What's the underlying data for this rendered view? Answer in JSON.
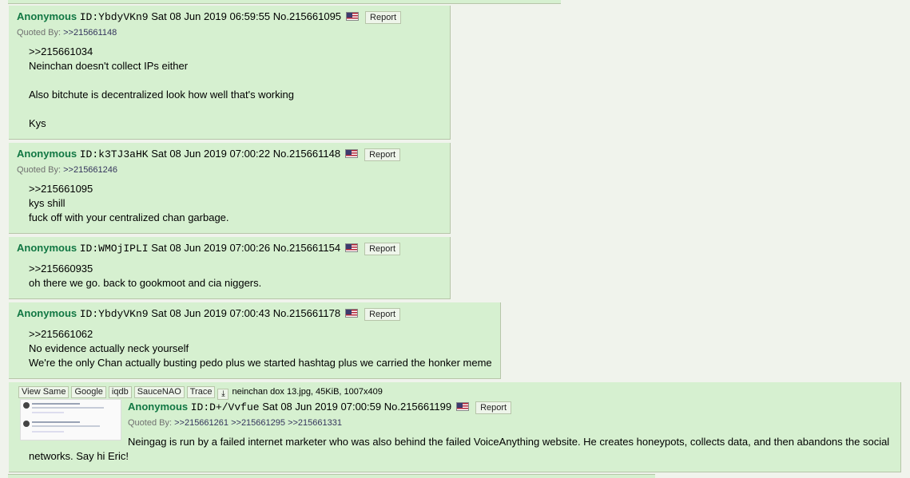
{
  "posts": [
    {
      "name": "Anonymous",
      "id": "ID:YbdyVKn9",
      "datetime": "Sat 08 Jun 2019 06:59:55",
      "no": "No.215661095",
      "report": "Report",
      "quoted_by_label": "Quoted By:",
      "quoted_by": [
        ">>215661148"
      ],
      "lines": [
        ">>215661034",
        "Neinchan doesn't collect IPs either",
        "",
        "Also bitchute is decentralized look how well that's working",
        "",
        "Kys"
      ]
    },
    {
      "name": "Anonymous",
      "id": "ID:k3TJ3aHK",
      "datetime": "Sat 08 Jun 2019 07:00:22",
      "no": "No.215661148",
      "report": "Report",
      "quoted_by_label": "Quoted By:",
      "quoted_by": [
        ">>215661246"
      ],
      "lines": [
        ">>215661095",
        "kys shill",
        "fuck off with your centralized chan garbage."
      ]
    },
    {
      "name": "Anonymous",
      "id": "ID:WMOjIPLI",
      "datetime": "Sat 08 Jun 2019 07:00:26",
      "no": "No.215661154",
      "report": "Report",
      "lines": [
        ">>215660935",
        "oh there we go. back to gookmoot and cia niggers."
      ]
    },
    {
      "name": "Anonymous",
      "id": "ID:YbdyVKn9",
      "datetime": "Sat 08 Jun 2019 07:00:43",
      "no": "No.215661178",
      "report": "Report",
      "lines": [
        ">>215661062",
        "No evidence actually neck yourself",
        "We're the only Chan actually busting pedo plus we started hashtag plus we carried the honker meme"
      ]
    },
    {
      "name": "Anonymous",
      "id": "ID:D+/Vvfue",
      "datetime": "Sat 08 Jun 2019 07:00:59",
      "no": "No.215661199",
      "report": "Report",
      "quoted_by_label": "Quoted By:",
      "quoted_by": [
        ">>215661261",
        ">>215661295",
        ">>215661331"
      ],
      "file_buttons": [
        "View Same",
        "Google",
        "iqdb",
        "SauceNAO",
        "Trace"
      ],
      "file_info": "neinchan dox 13.jpg, 45KiB, 1007x409",
      "lines": [
        "Neingag is run by a failed internet marketer who was also behind the failed VoiceAnything website. He creates honeypots, collects data, and then abandons the social",
        "networks. Say hi Eric!"
      ]
    }
  ]
}
